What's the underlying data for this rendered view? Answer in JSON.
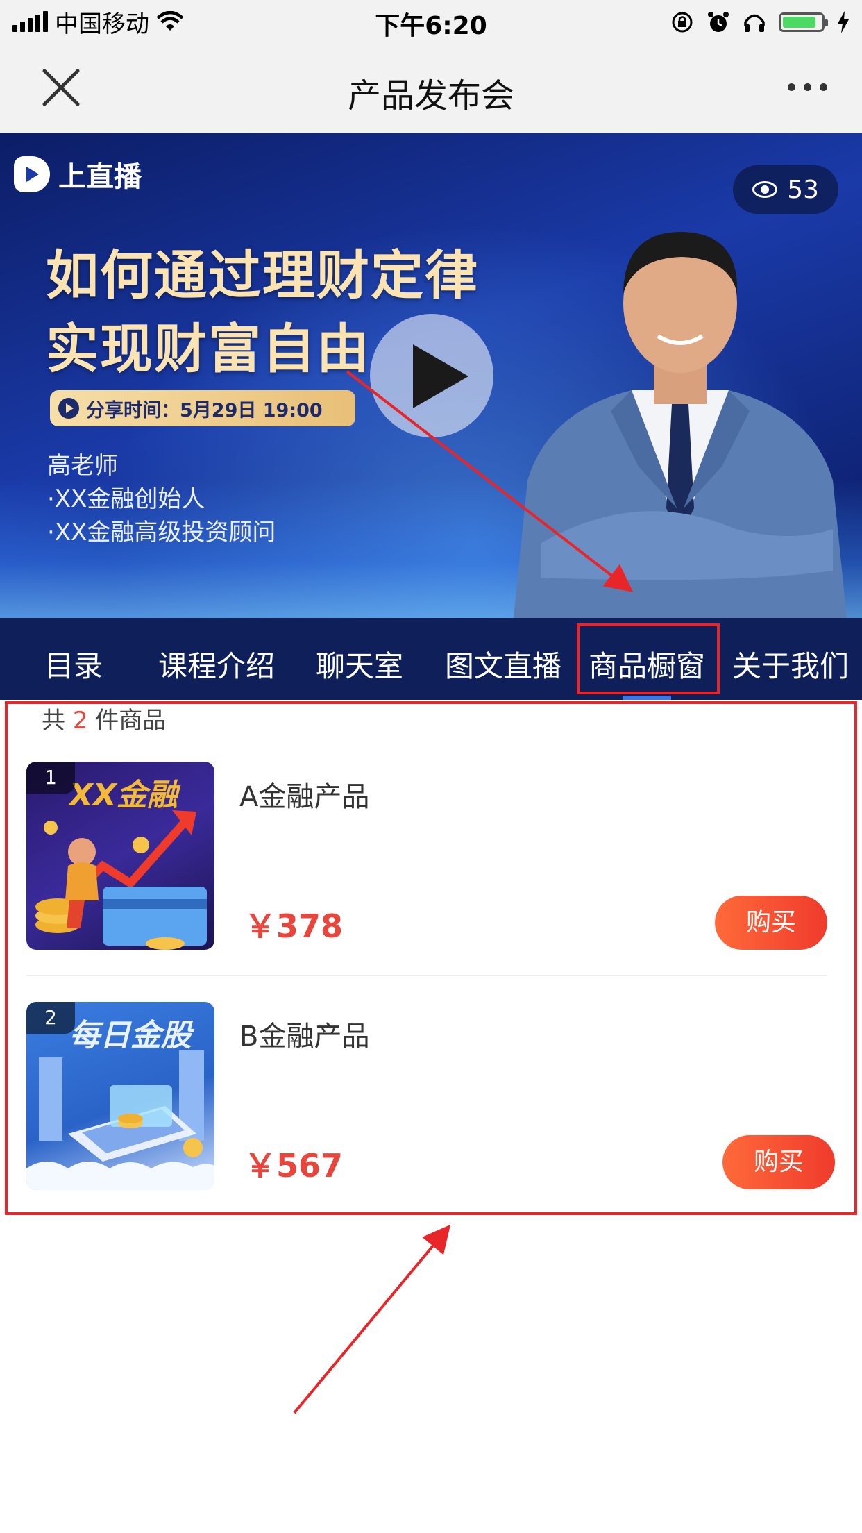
{
  "status_bar": {
    "carrier": "中国移动",
    "time": "下午6:20"
  },
  "nav": {
    "title": "产品发布会"
  },
  "banner": {
    "logo_text": "上直播",
    "viewer_count": "53",
    "headline_line1": "如何通过理财定律",
    "headline_line2": "实现财富自由",
    "share_time": "分享时间：5月29日 19:00",
    "teacher_name": "高老师",
    "teacher_title1": "·XX金融创始人",
    "teacher_title2": "·XX金融高级投资顾问"
  },
  "tabs": [
    {
      "label": "目录"
    },
    {
      "label": "课程介绍"
    },
    {
      "label": "聊天室"
    },
    {
      "label": "图文直播"
    },
    {
      "label": "商品橱窗"
    },
    {
      "label": "关于我们"
    }
  ],
  "product_list": {
    "count_prefix": "共",
    "count": "2",
    "count_suffix": "件商品",
    "items": [
      {
        "index": "1",
        "thumb_text": "XX金融",
        "name": "A金融产品",
        "price": "￥378",
        "buy_label": "购买"
      },
      {
        "index": "2",
        "thumb_text": "每日金股",
        "name": "B金融产品",
        "price": "￥567",
        "buy_label": "购买"
      }
    ]
  },
  "colors": {
    "accent_red": "#e8453c",
    "tab_bar": "#0e1f5a",
    "annotation": "#e8262a"
  }
}
